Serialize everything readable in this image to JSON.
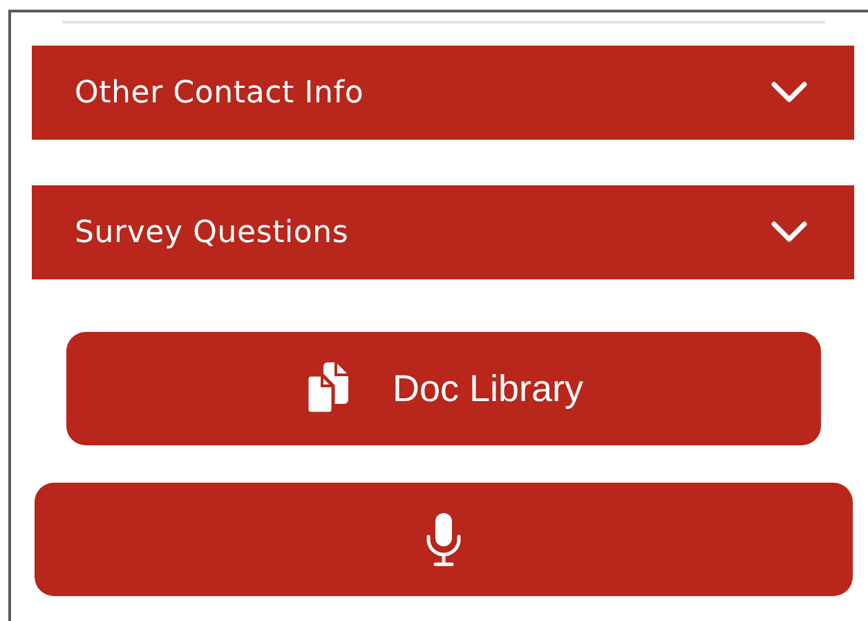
{
  "sections": [
    {
      "title": "Other Contact Info",
      "expanded": false
    },
    {
      "title": "Survey Questions",
      "expanded": false
    }
  ],
  "buttons": [
    {
      "kind": "documents",
      "label": "Doc Library"
    },
    {
      "kind": "microphone"
    }
  ]
}
